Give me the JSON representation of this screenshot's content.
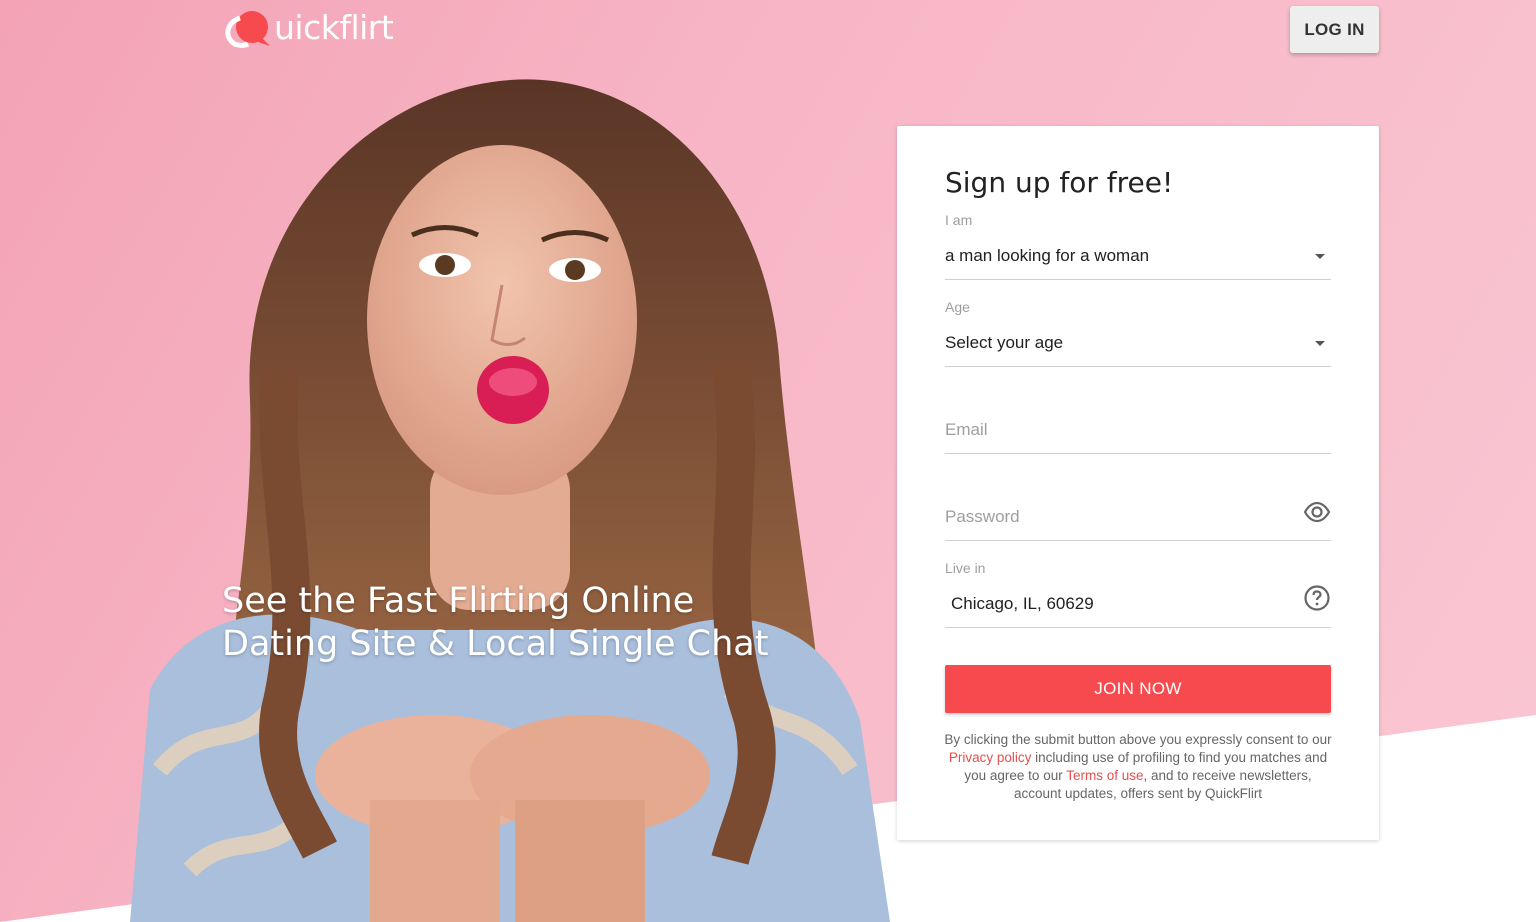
{
  "brand": {
    "logo_text": "uickflirt",
    "accent_color": "#f64a4e",
    "background_color": "#f7b8c6"
  },
  "header": {
    "login_label": "LOG IN"
  },
  "hero": {
    "headline_line1": "See the Fast Flirting Online",
    "headline_line2": "Dating Site & Local Single Chat"
  },
  "signup": {
    "title": "Sign up for free!",
    "i_am": {
      "label": "I am",
      "value": "a man looking for a woman"
    },
    "age": {
      "label": "Age",
      "value": "Select your age"
    },
    "email": {
      "placeholder": "Email"
    },
    "password": {
      "placeholder": "Password",
      "icon": "eye-icon"
    },
    "live_in": {
      "label": "Live in",
      "value": "Chicago, IL, 60629",
      "icon": "help-circle-icon"
    },
    "join_label": "JOIN NOW",
    "consent": {
      "part1": "By clicking the submit button above you expressly consent to our ",
      "privacy_link": "Privacy policy",
      "part2": " including use of profiling to find you matches and you agree to our ",
      "terms_link": "Terms of use",
      "part3": ", and to receive newsletters, account updates, offers sent by QuickFlirt"
    }
  }
}
